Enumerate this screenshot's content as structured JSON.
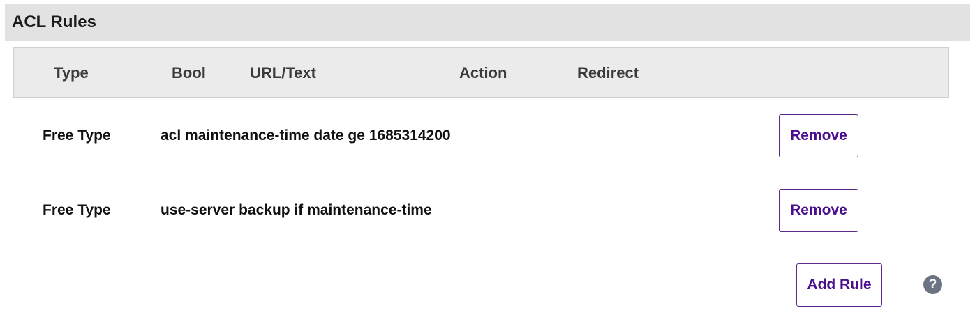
{
  "panel": {
    "title": "ACL Rules"
  },
  "table": {
    "headers": {
      "type": "Type",
      "bool": "Bool",
      "url_text": "URL/Text",
      "action": "Action",
      "redirect": "Redirect"
    },
    "rows": [
      {
        "type": "Free Type",
        "url_text": "acl maintenance-time date ge 1685314200",
        "remove_label": "Remove"
      },
      {
        "type": "Free Type",
        "url_text": "use-server backup if maintenance-time",
        "remove_label": "Remove"
      }
    ]
  },
  "actions": {
    "add_rule_label": "Add Rule",
    "help_glyph": "?",
    "help_icon": "question-circle-icon"
  },
  "colors": {
    "header_bg": "#e2e2e2",
    "table_head_bg": "#ebebeb",
    "button_text": "#4b0e8f",
    "button_border": "#5b2a8c",
    "help_icon_bg": "#6b7482"
  }
}
